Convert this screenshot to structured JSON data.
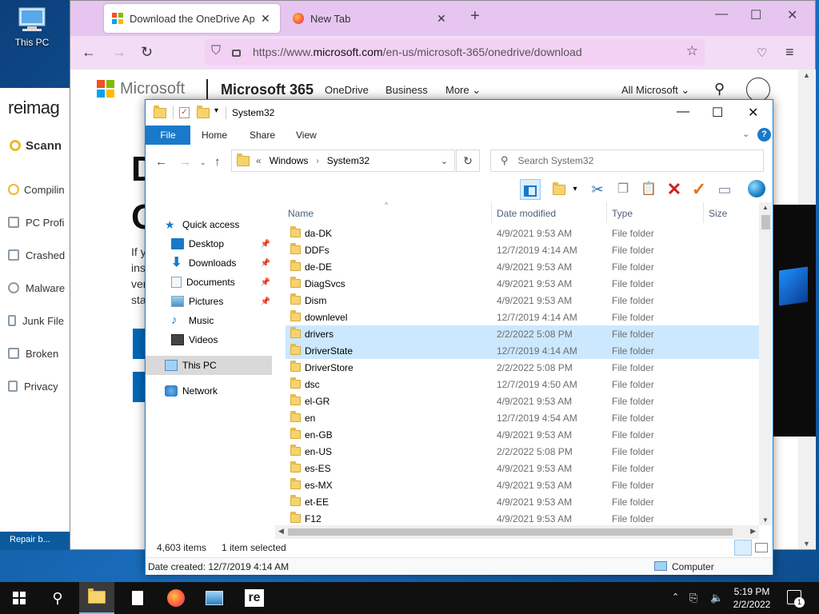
{
  "desktop": {
    "icons": [
      {
        "label": "This PC",
        "icon": "computer-icon"
      }
    ]
  },
  "reimage": {
    "brand": "reimag",
    "scanning": "Scann",
    "items": [
      "Compilin",
      "PC Profi",
      "Crashed",
      "Malware",
      "Junk File",
      "Broken",
      "Privacy"
    ],
    "footer": "Repair b..."
  },
  "firefox": {
    "tabs": [
      {
        "title": "Download the OneDrive App fo",
        "active": true
      },
      {
        "title": "New Tab",
        "active": false
      }
    ],
    "url_prefix": "https://www.",
    "url_host": "microsoft.com",
    "url_path": "/en-us/microsoft-365/onedrive/download",
    "page": {
      "brand": "Microsoft",
      "product": "Microsoft 365",
      "nav": [
        "OneDrive",
        "Business",
        "More ⌄"
      ],
      "all_ms": "All Microsoft ⌄",
      "big1": "D",
      "big2": "O",
      "frags": [
        "If y",
        "ins",
        "ver",
        "sta"
      ]
    }
  },
  "explorer": {
    "title": "System32",
    "ribbon_tabs": [
      "File",
      "Home",
      "Share",
      "View"
    ],
    "breadcrumb": [
      "«",
      "Windows",
      "System32"
    ],
    "search_placeholder": "Search System32",
    "nav_items": [
      {
        "label": "Quick access",
        "icon": "star-icon",
        "pinned": false
      },
      {
        "label": "Desktop",
        "icon": "desktop-icon",
        "pinned": true
      },
      {
        "label": "Downloads",
        "icon": "download-icon",
        "pinned": true
      },
      {
        "label": "Documents",
        "icon": "document-icon",
        "pinned": true
      },
      {
        "label": "Pictures",
        "icon": "pictures-icon",
        "pinned": true
      },
      {
        "label": "Music",
        "icon": "music-icon",
        "pinned": false
      },
      {
        "label": "Videos",
        "icon": "video-icon",
        "pinned": false
      },
      {
        "label": "This PC",
        "icon": "computer-icon",
        "pinned": false,
        "selected": true
      },
      {
        "label": "Network",
        "icon": "network-icon",
        "pinned": false
      }
    ],
    "columns": [
      "Name",
      "Date modified",
      "Type",
      "Size"
    ],
    "rows": [
      {
        "name": "da-DK",
        "date": "4/9/2021 9:53 AM",
        "type": "File folder"
      },
      {
        "name": "DDFs",
        "date": "12/7/2019 4:14 AM",
        "type": "File folder"
      },
      {
        "name": "de-DE",
        "date": "4/9/2021 9:53 AM",
        "type": "File folder"
      },
      {
        "name": "DiagSvcs",
        "date": "4/9/2021 9:53 AM",
        "type": "File folder"
      },
      {
        "name": "Dism",
        "date": "4/9/2021 9:53 AM",
        "type": "File folder"
      },
      {
        "name": "downlevel",
        "date": "12/7/2019 4:14 AM",
        "type": "File folder"
      },
      {
        "name": "drivers",
        "date": "2/2/2022 5:08 PM",
        "type": "File folder",
        "selected": true
      },
      {
        "name": "DriverState",
        "date": "12/7/2019 4:14 AM",
        "type": "File folder",
        "selected": true
      },
      {
        "name": "DriverStore",
        "date": "2/2/2022 5:08 PM",
        "type": "File folder"
      },
      {
        "name": "dsc",
        "date": "12/7/2019 4:50 AM",
        "type": "File folder"
      },
      {
        "name": "el-GR",
        "date": "4/9/2021 9:53 AM",
        "type": "File folder"
      },
      {
        "name": "en",
        "date": "12/7/2019 4:54 AM",
        "type": "File folder"
      },
      {
        "name": "en-GB",
        "date": "4/9/2021 9:53 AM",
        "type": "File folder"
      },
      {
        "name": "en-US",
        "date": "2/2/2022 5:08 PM",
        "type": "File folder"
      },
      {
        "name": "es-ES",
        "date": "4/9/2021 9:53 AM",
        "type": "File folder"
      },
      {
        "name": "es-MX",
        "date": "4/9/2021 9:53 AM",
        "type": "File folder"
      },
      {
        "name": "et-EE",
        "date": "4/9/2021 9:53 AM",
        "type": "File folder"
      },
      {
        "name": "F12",
        "date": "4/9/2021 9:53 AM",
        "type": "File folder"
      }
    ],
    "item_count": "4,603 items",
    "selection": "1 item selected",
    "details": "Date created: 12/7/2019 4:14 AM",
    "location": "Computer"
  },
  "taskbar": {
    "time": "5:19 PM",
    "date": "2/2/2022",
    "notification_count": "1",
    "apps": [
      "start-icon",
      "search-icon",
      "file-explorer-icon",
      "notepad-icon",
      "firefox-icon",
      "control-panel-icon",
      "reimage-icon"
    ]
  },
  "colors": {
    "accent": "#1979ca",
    "selection": "#cce8ff",
    "firefox_tabbar": "#e6c5f0"
  }
}
